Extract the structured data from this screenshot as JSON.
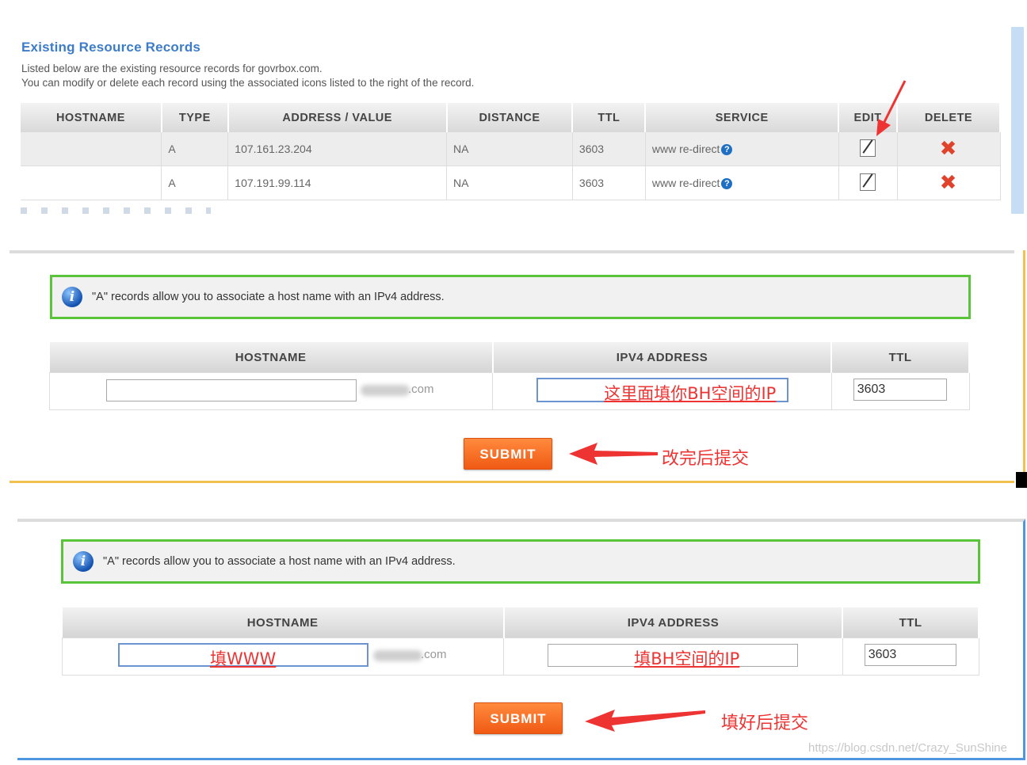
{
  "records_section": {
    "title": "Existing Resource Records",
    "desc_line1": "Listed below are the existing resource records for govrbox.com.",
    "desc_line2": "You can modify or delete each record using the associated icons listed to the right of the record.",
    "columns": [
      "HOSTNAME",
      "TYPE",
      "ADDRESS / VALUE",
      "DISTANCE",
      "TTL",
      "SERVICE",
      "EDIT",
      "DELETE"
    ],
    "rows": [
      {
        "hostname": "",
        "type": "A",
        "address": "107.161.23.204",
        "distance": "NA",
        "ttl": "3603",
        "service": "www re-direct"
      },
      {
        "hostname": "",
        "type": "A",
        "address": "107.191.99.114",
        "distance": "NA",
        "ttl": "3603",
        "service": "www re-direct"
      }
    ],
    "help_glyph": "?",
    "edit_icon": "edit-icon",
    "delete_icon": "delete-icon",
    "delete_glyph": "✖"
  },
  "form1": {
    "info_text": "\"A\" records allow you to associate a host name with an IPv4 address.",
    "info_glyph": "i",
    "columns": [
      "HOSTNAME",
      "IPV4 ADDRESS",
      "TTL"
    ],
    "hostname_value": "",
    "domain_suffix": ".com",
    "ipv4_note": "这里面填你BH空间的IP",
    "ttl_value": "3603",
    "submit_label": "SUBMIT",
    "arrow_note": "改完后提交"
  },
  "form2": {
    "info_text": "\"A\" records allow you to associate a host name with an IPv4 address.",
    "info_glyph": "i",
    "columns": [
      "HOSTNAME",
      "IPV4 ADDRESS",
      "TTL"
    ],
    "hostname_note": "填WWW",
    "domain_suffix": ".com",
    "ipv4_note": "填BH空间的IP",
    "ttl_value": "3603",
    "submit_label": "SUBMIT",
    "arrow_note": "填好后提交"
  },
  "watermark": "https://blog.csdn.net/Crazy_SunShine",
  "colors": {
    "title_blue": "#3d7cc9",
    "info_border_green": "#59c43a",
    "submit_orange": "#f05a14",
    "annotation_red": "#e33333",
    "panel2_border_yellow": "#f2c24f",
    "panel3_border_blue": "#4e97e0"
  }
}
